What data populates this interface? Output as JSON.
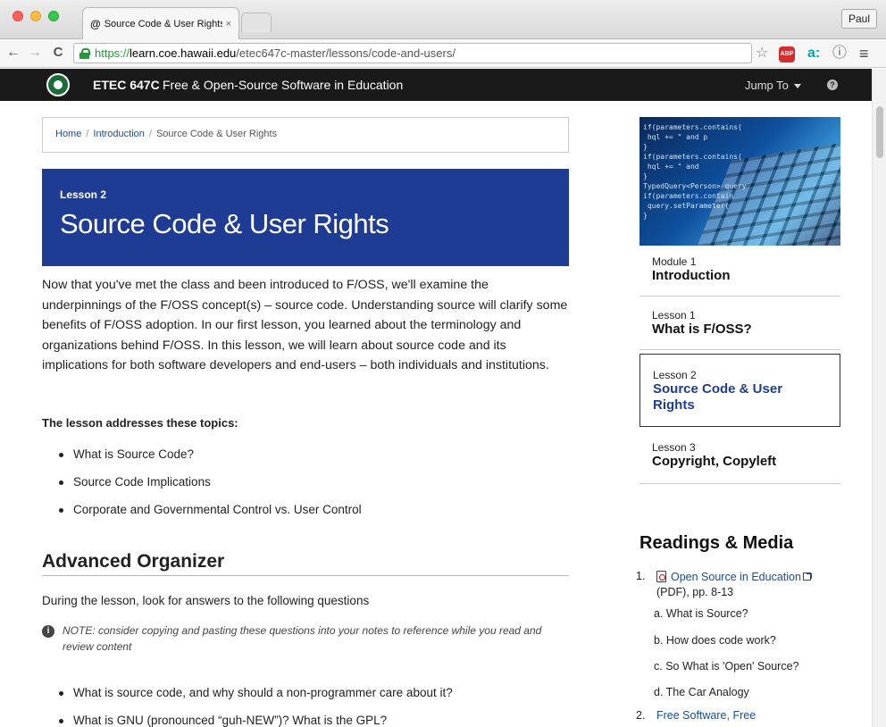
{
  "browser": {
    "tab_title": "Source Code & User Rights",
    "tab_favicon": "@",
    "tab_close": "×",
    "profile": "Paul",
    "url_scheme": "https://",
    "url_host": "learn.coe.hawaii.edu",
    "url_path": "/etec647c-master/lessons/code-and-users/",
    "icons": {
      "back": "←",
      "forward": "→",
      "reload": "C",
      "star": "☆",
      "abp": "ABP",
      "amazon": "a:",
      "info": "ⓘ",
      "menu": "≡"
    }
  },
  "site": {
    "course_code": "ETEC 647C",
    "course_title": "Free & Open-Source Software in Education",
    "jump_to": "Jump To",
    "help_glyph": "?"
  },
  "breadcrumb": {
    "home": "Home",
    "sep": "/",
    "intro": "Introduction",
    "current": "Source Code & User Rights"
  },
  "lesson": {
    "number": "Lesson 2",
    "title": "Source Code & User Rights"
  },
  "intro_text": "Now that you've met the class and been introduced to F/OSS, we'll examine the underpinnings of the F/OSS concept(s) – source code. Understanding source will clarify some benefits of F/OSS adoption. In our first lesson, you learned about the terminology and organizations behind F/OSS. In this lesson, we will learn about source code and its implications for both software developers and end-users – both individuals and institutions.",
  "topics": {
    "heading": "The lesson addresses these topics:",
    "items": [
      "What is Source Code?",
      "Source Code Implications",
      "Corporate and Governmental Control vs. User Control"
    ]
  },
  "advanced": {
    "heading": "Advanced Organizer",
    "during": "During the lesson, look for answers to the following questions",
    "note_icon": "i",
    "note": "NOTE: consider copying and pasting these questions into your notes to reference while you read and review content",
    "questions": [
      "What is source code, and why should a non-programmer care about it?",
      "What is GNU (pronounced “guh-NEW”)? What is the GPL?"
    ]
  },
  "sidebar": {
    "image_code": "if(parameters.contains(\n hql += \" and p\n}\nif(parameters.contains(\n hql += \" and\n}\nTypedQuery<Person> query\nif(parameters.contain\n query.setParameter(\n}",
    "modules": [
      {
        "small": "Module 1",
        "big": "Introduction"
      },
      {
        "small": "Lesson 1",
        "big": "What is F/OSS?"
      },
      {
        "small": "Lesson 2",
        "big": "Source Code & User Rights"
      },
      {
        "small": "Lesson 3",
        "big": "Copyright, Copyleft"
      }
    ],
    "readings_heading": "Readings & Media",
    "readings": [
      {
        "num": "1.",
        "link": "Open Source in Education",
        "suffix": "(PDF), pp. 8-13",
        "subs": [
          "a.  What is Source?",
          "b.  How does code work?",
          "c.  So What is 'Open' Source?",
          "d.  The Car Analogy"
        ]
      },
      {
        "num": "2.",
        "link": "Free Software, Free"
      }
    ]
  }
}
